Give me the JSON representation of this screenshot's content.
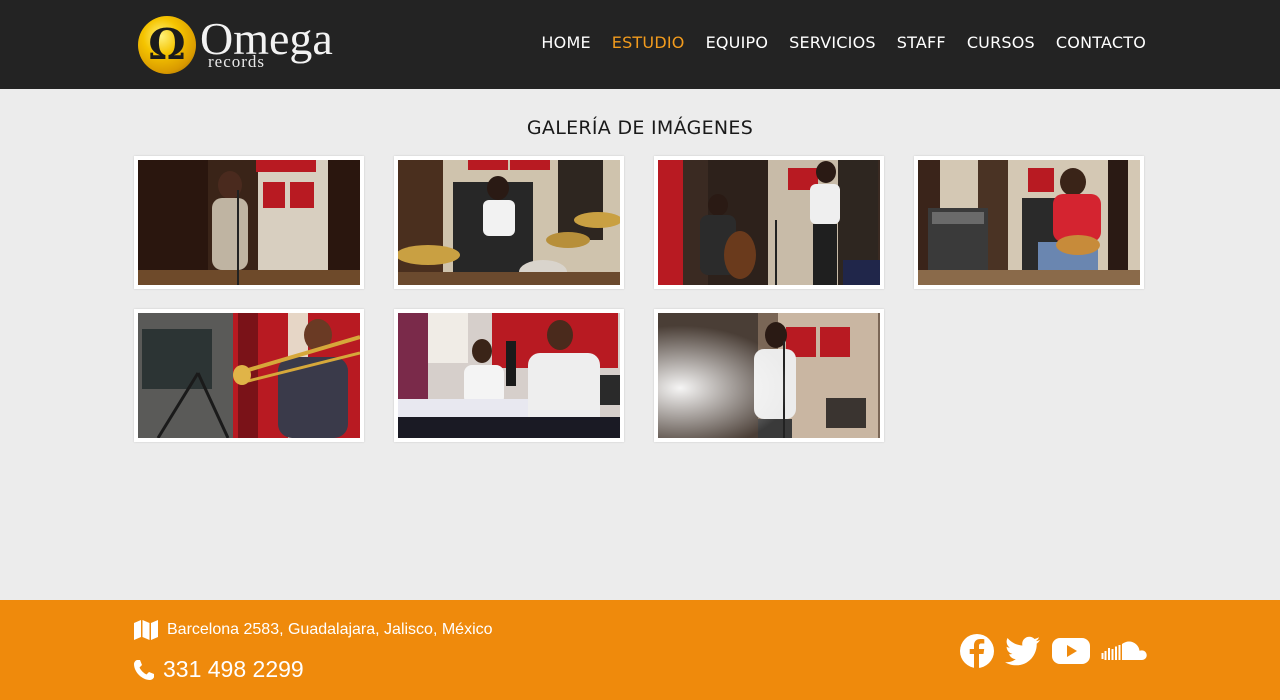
{
  "brand": {
    "name": "Omega",
    "sub": "records",
    "symbol": "Ω"
  },
  "nav": [
    {
      "label": "HOME"
    },
    {
      "label": "ESTUDIO",
      "active": true
    },
    {
      "label": "EQUIPO"
    },
    {
      "label": "SERVICIOS"
    },
    {
      "label": "STAFF"
    },
    {
      "label": "CURSOS"
    },
    {
      "label": "CONTACTO"
    }
  ],
  "gallery": {
    "title": "GALERÍA DE IMÁGENES"
  },
  "footer": {
    "address": "Barcelona 2583, Guadalajara, Jalisco, México",
    "phone": "331 498 2299",
    "social": [
      "facebook-icon",
      "twitter-icon",
      "youtube-icon",
      "soundcloud-icon"
    ]
  },
  "colors": {
    "header_bg": "#232323",
    "accent": "#f29b1d",
    "footer_bg": "#ef8a0c",
    "page_bg": "#ececec"
  }
}
